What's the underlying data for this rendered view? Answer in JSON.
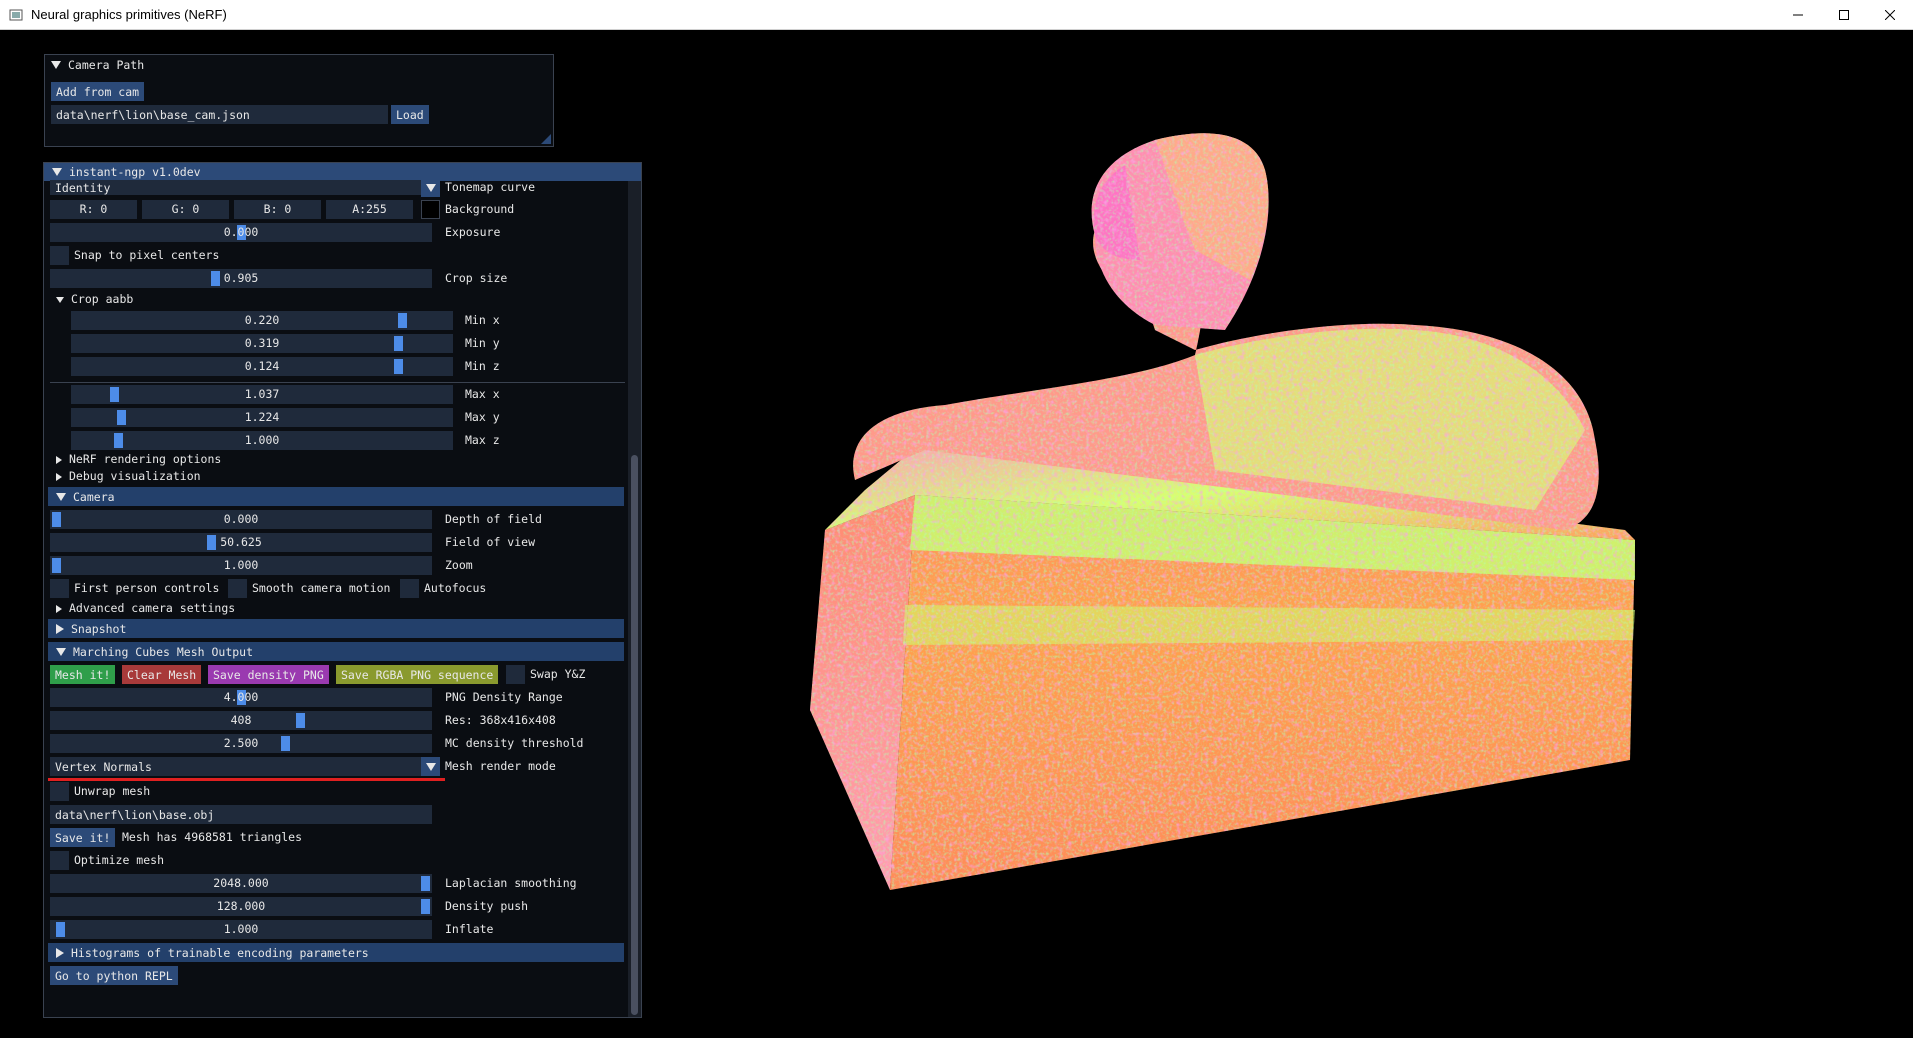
{
  "window": {
    "title": "Neural graphics primitives (NeRF)"
  },
  "camera_path": {
    "header": "Camera Path",
    "add_from_cam": "Add from cam",
    "path_value": "data\\nerf\\lion\\base_cam.json",
    "load": "Load"
  },
  "main": {
    "header": "instant-ngp v1.0dev",
    "tonemap": {
      "value": "Identity",
      "label": "Tonemap curve"
    },
    "background": {
      "r": "R:  0",
      "g": "G:  0",
      "b": "B:  0",
      "a": "A:255",
      "label": "Background",
      "swatch_color": "#000000"
    },
    "exposure": {
      "value": "0.000",
      "label": "Exposure",
      "level": 0.5
    },
    "snap": {
      "label": "Snap to pixel centers"
    },
    "crop_size": {
      "value": "0.905",
      "label": "Crop size",
      "level": 0.43
    },
    "crop_aabb": {
      "label": "Crop aabb",
      "min_x": {
        "value": "0.220",
        "label": "Min x",
        "level": 0.88
      },
      "min_y": {
        "value": "0.319",
        "label": "Min y",
        "level": 0.87
      },
      "min_z": {
        "value": "0.124",
        "label": "Min z",
        "level": 0.87
      },
      "max_x": {
        "value": "1.037",
        "label": "Max x",
        "level": 0.1
      },
      "max_y": {
        "value": "1.224",
        "label": "Max y",
        "level": 0.12
      },
      "max_z": {
        "value": "1.000",
        "label": "Max z",
        "level": 0.11
      }
    },
    "nerf_rendering": "NeRF rendering options",
    "debug_vis": "Debug visualization",
    "camera": {
      "header": "Camera",
      "dof": {
        "value": "0.000",
        "label": "Depth of field",
        "level": 0.0
      },
      "fov": {
        "value": "50.625",
        "label": "Field of view",
        "level": 0.42
      },
      "zoom": {
        "value": "1.000",
        "label": "Zoom",
        "level": 0.0
      },
      "first_person": "First person controls",
      "smooth": "Smooth camera motion",
      "autofocus": "Autofocus",
      "advanced": "Advanced camera settings"
    },
    "snapshot": "Snapshot",
    "mc": {
      "header": "Marching Cubes Mesh Output",
      "mesh_it": "Mesh it!",
      "clear_mesh": "Clear Mesh",
      "save_density": "Save density PNG",
      "save_rgba": "Save RGBA PNG sequence",
      "swap_yz": "Swap Y&Z",
      "png_density": {
        "value": "4.000",
        "label": "PNG Density Range",
        "level": 0.5
      },
      "res": {
        "value": "408",
        "label": "Res: 368x416x408",
        "level": 0.66
      },
      "mc_threshold": {
        "value": "2.500",
        "label": "MC density threshold",
        "level": 0.62
      },
      "render_mode": {
        "value": "Vertex Normals",
        "label": "Mesh render mode"
      },
      "unwrap": "Unwrap mesh",
      "obj_path": "data\\nerf\\lion\\base.obj",
      "save_it": "Save it!",
      "triangles": "Mesh has 4968581 triangles",
      "optimize": "Optimize mesh",
      "laplacian": {
        "value": "2048.000",
        "label": "Laplacian smoothing",
        "level": 1.0
      },
      "density_push": {
        "value": "128.000",
        "label": "Density push",
        "level": 1.0
      },
      "inflate": {
        "value": "1.000",
        "label": "Inflate",
        "level": 0.01
      }
    },
    "histograms": "Histograms of trainable encoding parameters",
    "python_repl": "Go to python REPL"
  },
  "colors": {
    "accent": "#4d8ce8",
    "header_bg": "#23406b",
    "button_bg": "#2c4a78",
    "mesh_it": "#2f9e4a",
    "clear_mesh": "#a83a3a",
    "save_density": "#9a3ab0",
    "save_rgba": "#8a9a2e",
    "underline": "#e02020"
  }
}
